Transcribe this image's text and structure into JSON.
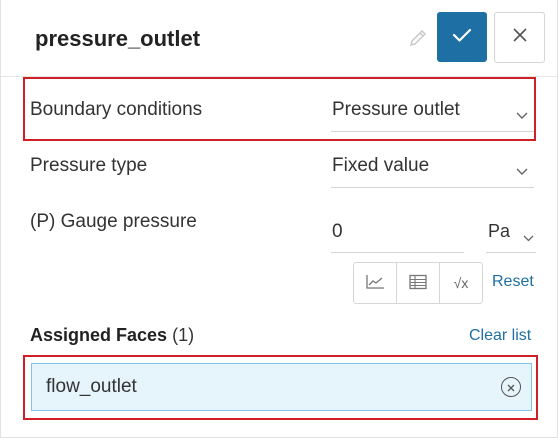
{
  "header": {
    "title": "pressure_outlet",
    "confirm_icon": "check-icon",
    "close_icon": "close-icon",
    "edit_icon": "pencil-icon"
  },
  "boundary": {
    "label": "Boundary conditions",
    "value": "Pressure outlet"
  },
  "pressure_type": {
    "label": "Pressure type",
    "value": "Fixed value"
  },
  "gauge": {
    "label": "(P) Gauge pressure",
    "value": "0",
    "unit": "Pa"
  },
  "tools": {
    "icons": [
      "chart-icon",
      "table-icon",
      "formula-icon"
    ],
    "formula_glyph": "√x",
    "reset": "Reset"
  },
  "assigned": {
    "title": "Assigned Faces",
    "count": "(1)",
    "clear": "Clear list"
  },
  "faces": [
    {
      "name": "flow_outlet"
    }
  ],
  "colors": {
    "accent": "#1e6fa3",
    "highlight": "#d01f26",
    "face_bg": "#e6f4fb"
  }
}
